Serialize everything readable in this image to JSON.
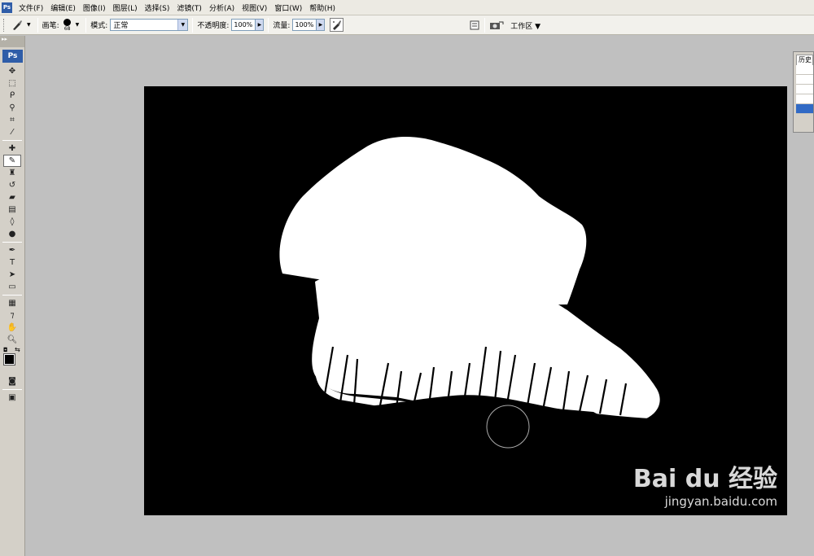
{
  "app": {
    "logo": "Ps"
  },
  "menu": {
    "items": [
      "文件(F)",
      "编辑(E)",
      "图像(I)",
      "图层(L)",
      "选择(S)",
      "滤镜(T)",
      "分析(A)",
      "视图(V)",
      "窗口(W)",
      "帮助(H)"
    ]
  },
  "options": {
    "brush_label": "画笔:",
    "brush_size": "68",
    "mode_label": "模式:",
    "mode_value": "正常",
    "opacity_label": "不透明度:",
    "opacity_value": "100%",
    "flow_label": "流量:",
    "flow_value": "100%",
    "workspace_label": "工作区"
  },
  "history": {
    "tab_label": "历史"
  },
  "watermark": {
    "logo_text": "Bai du 经验",
    "url": "jingyan.baidu.com"
  },
  "colors": {
    "menubar": "#eceae3",
    "workspace": "#c0c0c0",
    "canvas_bg": "#000000",
    "mask_fg": "#ffffff",
    "accent": "#2f5da8",
    "selection": "#316ac5"
  }
}
